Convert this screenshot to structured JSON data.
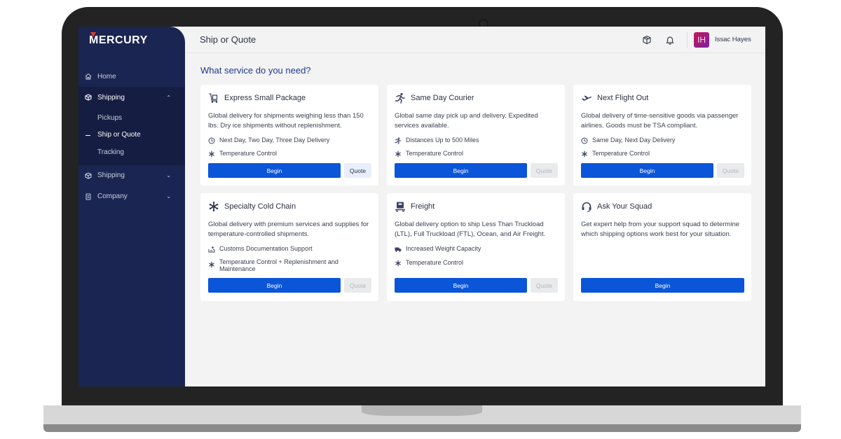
{
  "brand": {
    "logo_text": "MERCURY",
    "accent": "#e63a2e",
    "sidebar_bg": "#1b2551",
    "primary": "#0b55d8"
  },
  "sidebar": {
    "items": [
      {
        "label": "Home",
        "icon": "home-icon"
      },
      {
        "label": "Shipping",
        "icon": "package-icon",
        "expanded": true
      },
      {
        "label": "Shipping",
        "icon": "package-icon",
        "expanded": false
      },
      {
        "label": "Company",
        "icon": "document-icon",
        "expanded": false
      }
    ],
    "sub_items": [
      {
        "label": "Pickups"
      },
      {
        "label": "Ship or Quote",
        "active": true
      },
      {
        "label": "Tracking"
      }
    ]
  },
  "header": {
    "title": "Ship or Quote",
    "user": {
      "initials": "IH",
      "name": "Issac Hayes"
    }
  },
  "main": {
    "section_title": "What service do you need?",
    "cards": [
      {
        "title": "Express Small Package",
        "icon": "hand-truck-icon",
        "description": "Global delivery for shipments weighing less than 150 lbs. Dry ice shipments without replenishment.",
        "features": [
          {
            "icon": "clock-icon",
            "text": "Next Day, Two Day, Three Day Delivery"
          },
          {
            "icon": "snowflake-icon",
            "text": "Temperature Control"
          }
        ],
        "begin_label": "Begin",
        "quote_label": "Quote",
        "quote_enabled": true
      },
      {
        "title": "Same Day Courier",
        "icon": "running-person-icon",
        "description": "Global same day pick up and delivery. Expedited services available.",
        "features": [
          {
            "icon": "running-person-icon",
            "text": "Distances Up to 500 Miles"
          },
          {
            "icon": "snowflake-icon",
            "text": "Temperature Control"
          }
        ],
        "begin_label": "Begin",
        "quote_label": "Quote",
        "quote_enabled": false
      },
      {
        "title": "Next Flight Out",
        "icon": "airplane-icon",
        "description": "Global delivery of time-sensitive goods via passenger airlines. Goods must be TSA compliant.",
        "features": [
          {
            "icon": "clock-icon",
            "text": "Same Day, Next Day Delivery"
          },
          {
            "icon": "snowflake-icon",
            "text": "Temperature Control"
          }
        ],
        "begin_label": "Begin",
        "quote_label": "Quote",
        "quote_enabled": false
      },
      {
        "title": "Specialty Cold Chain",
        "icon": "snowflake-icon",
        "description": "Global delivery with premium services and supplies for temperature-controlled shipments.",
        "features": [
          {
            "icon": "customs-icon",
            "text": "Customs Documentation Support"
          },
          {
            "icon": "snowflake-icon",
            "text": "Temperature Control + Replenishment and Maintenance"
          }
        ],
        "begin_label": "Begin",
        "quote_label": "Quote",
        "quote_enabled": false
      },
      {
        "title": "Freight",
        "icon": "pallet-icon",
        "description": "Global delivery option to ship Less Than Truckload (LTL), Full Truckload (FTL), Ocean, and Air Freight.",
        "features": [
          {
            "icon": "truck-icon",
            "text": "Increased Weight Capacity"
          },
          {
            "icon": "snowflake-icon",
            "text": "Temperature Control"
          }
        ],
        "begin_label": "Begin",
        "quote_label": "Quote",
        "quote_enabled": false
      },
      {
        "title": "Ask Your Squad",
        "icon": "headset-icon",
        "description": "Get expert help from your support squad to determine which shipping options work best for your situation.",
        "features": [],
        "begin_label": "Begin"
      }
    ]
  }
}
